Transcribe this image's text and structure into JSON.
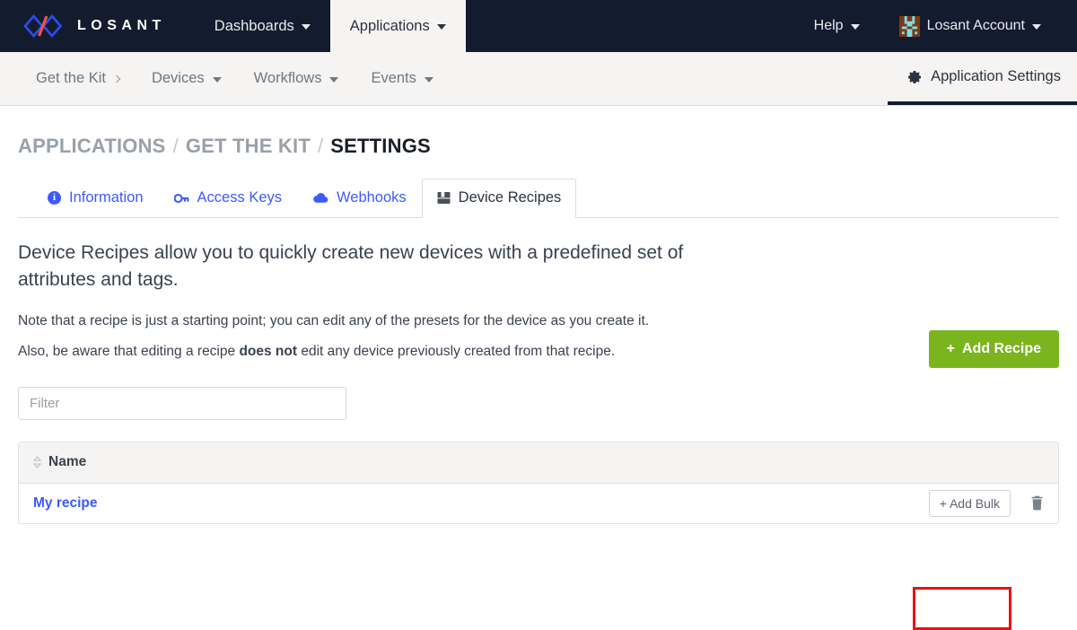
{
  "topnav": {
    "brand": {
      "logo_icon": "losant-diamond-logo",
      "text": "LOSANT",
      "blue": "#2b4df0",
      "red": "#f4523b"
    },
    "items": [
      {
        "label": "Dashboards",
        "icon": "chevron-down-icon",
        "active": false
      },
      {
        "label": "Applications",
        "icon": "chevron-down-icon",
        "active": true
      }
    ],
    "right": [
      {
        "label": "Help",
        "icon": "chevron-down-icon"
      },
      {
        "label": "Losant Account",
        "icon": "avatar-identicon"
      }
    ],
    "background": "#121c2e"
  },
  "subnav": {
    "items": [
      {
        "label": "Get the Kit",
        "icon": "chevron-right-icon"
      },
      {
        "label": "Devices",
        "icon": "chevron-down-icon"
      },
      {
        "label": "Workflows",
        "icon": "chevron-down-icon"
      },
      {
        "label": "Events",
        "icon": "chevron-down-icon"
      }
    ],
    "settings": {
      "label": "Application Settings",
      "icon": "gear-icon",
      "active": true
    },
    "background": "#f5f4f2"
  },
  "breadcrumb": {
    "level1": "APPLICATIONS",
    "sep1": "/",
    "level2": "GET THE KIT",
    "sep2": "/",
    "current": "SETTINGS"
  },
  "tabs": [
    {
      "label": "Information",
      "icon": "info-circle-icon",
      "active": false
    },
    {
      "label": "Access Keys",
      "icon": "key-icon",
      "active": false
    },
    {
      "label": "Webhooks",
      "icon": "cloud-icon",
      "active": false
    },
    {
      "label": "Device Recipes",
      "icon": "book-icon",
      "active": true
    }
  ],
  "main": {
    "intro": "Device Recipes allow you to quickly create new devices with a predefined set of attributes and tags.",
    "note1": "Note that a recipe is just a starting point; you can edit any of the presets for the device as you create it.",
    "note2_pre": "Also, be aware that editing a recipe ",
    "note2_bold": "does not",
    "note2_post": " edit any device previously created from that recipe.",
    "add_recipe_label": "Add Recipe",
    "add_recipe_plus": "+",
    "add_recipe_color": "#7ab51d",
    "filter_placeholder": "Filter",
    "filter_value": ""
  },
  "table": {
    "columns": [
      {
        "label": "Name",
        "icon": "sort-icon",
        "sortable": true
      }
    ],
    "rows": [
      {
        "name": "My recipe",
        "add_bulk_label": "Add Bulk",
        "add_bulk_plus": "+",
        "delete_icon": "trash-icon"
      }
    ]
  },
  "annotation": {
    "color": "#ee1111",
    "target": "add-bulk-button"
  }
}
